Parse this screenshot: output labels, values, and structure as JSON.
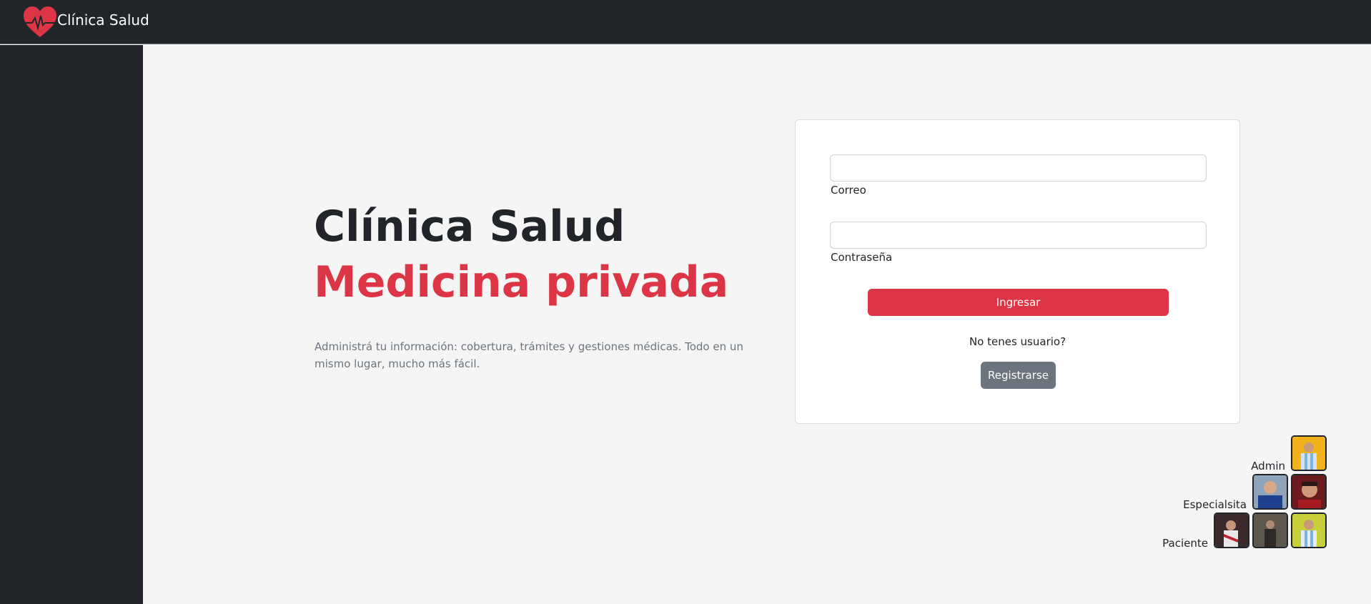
{
  "navbar": {
    "brand_name": "Clínica Salud",
    "logo_icon": "heart-pulse-icon",
    "logo_color": "#dc3545"
  },
  "hero": {
    "title_line1": "Clínica Salud",
    "title_line2": "Medicina privada",
    "description": "Administrá tu información: cobertura, trámites y gestiones médicas. Todo en un mismo lugar, mucho más fácil."
  },
  "login": {
    "email_value": "",
    "email_label": "Correo",
    "password_value": "",
    "password_label": "Contraseña",
    "submit_label": "Ingresar",
    "no_user_text": "No tenes usuario?",
    "register_label": "Registrarse"
  },
  "quick_access": {
    "admin_label": "Admin",
    "specialist_label": "Especialsita",
    "patient_label": "Paciente"
  },
  "colors": {
    "dark": "#212529",
    "accent": "#dc3545",
    "secondary": "#6c757d",
    "background": "#f5f5f5"
  }
}
